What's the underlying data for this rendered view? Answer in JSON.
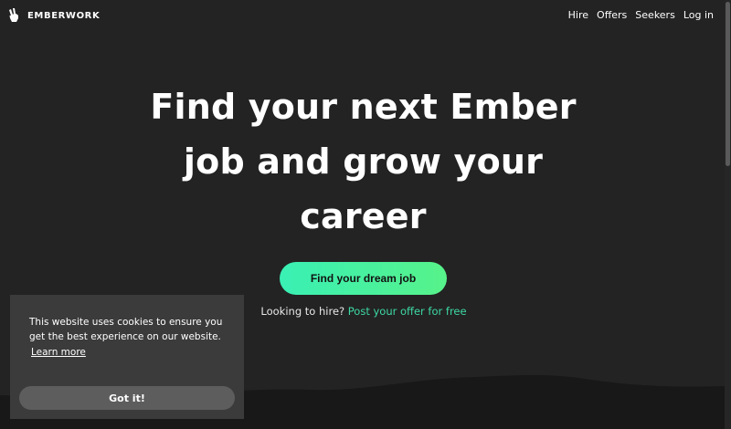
{
  "brand": {
    "name": "EMBERWORK",
    "logo_icon": "hand-peace-icon"
  },
  "nav": {
    "items": [
      "Hire",
      "Offers",
      "Seekers",
      "Log in"
    ]
  },
  "hero": {
    "title": "Find your next Ember job and grow your career",
    "cta_label": "Find your dream job",
    "hire_prompt": "Looking to hire?",
    "hire_link": "Post your offer for free"
  },
  "cookie_banner": {
    "message": "This website uses cookies to ensure you get the best experience on our website.",
    "learn_more": "Learn more",
    "accept_label": "Got it!"
  },
  "colors": {
    "background": "#232323",
    "accent": "#3ed9a6",
    "cta_gradient_start": "#39f0b4",
    "cta_gradient_end": "#57f28a",
    "cookie_bg": "#3b3b3b",
    "cookie_button": "#5d5d5d"
  }
}
